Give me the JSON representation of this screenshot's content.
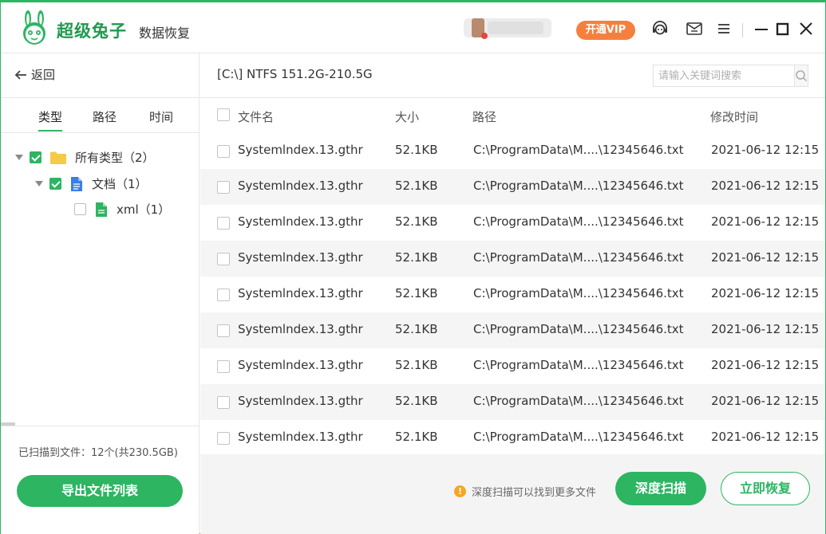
{
  "app": {
    "brand": "超级兔子",
    "product": "数据恢复",
    "vip_label": "开通VIP"
  },
  "titlebar_icons": [
    "support-icon",
    "message-icon",
    "menu-icon",
    "minimize-icon",
    "maximize-icon",
    "close-icon"
  ],
  "sidebar": {
    "back_label": "返回",
    "tabs": [
      {
        "label": "类型",
        "active": true
      },
      {
        "label": "路径",
        "active": false
      },
      {
        "label": "时间",
        "active": false
      }
    ],
    "tree": [
      {
        "label": "所有类型（2）",
        "checked": true,
        "icon": "folder-icon"
      },
      {
        "label": "文档（1）",
        "checked": true,
        "icon": "document-icon"
      },
      {
        "label": "xml（1）",
        "checked": false,
        "icon": "xml-file-icon"
      }
    ],
    "scan_count": "已扫描到文件：12个(共230.5GB)",
    "export_label": "导出文件列表"
  },
  "main": {
    "path_label": "[C:\\] NTFS 151.2G-210.5G",
    "search_placeholder": "请输入关键词搜索",
    "columns": [
      "文件名",
      "大小",
      "路径",
      "修改时间"
    ],
    "rows": [
      {
        "name": "Systemlndex.13.gthr",
        "size": "52.1KB",
        "path": "C:\\ProgramData\\M....\\12345646.txt",
        "modified": "2021-06-12 12:15"
      },
      {
        "name": "Systemlndex.13.gthr",
        "size": "52.1KB",
        "path": "C:\\ProgramData\\M....\\12345646.txt",
        "modified": "2021-06-12 12:15"
      },
      {
        "name": "Systemlndex.13.gthr",
        "size": "52.1KB",
        "path": "C:\\ProgramData\\M....\\12345646.txt",
        "modified": "2021-06-12 12:15"
      },
      {
        "name": "Systemlndex.13.gthr",
        "size": "52.1KB",
        "path": "C:\\ProgramData\\M....\\12345646.txt",
        "modified": "2021-06-12 12:15"
      },
      {
        "name": "Systemlndex.13.gthr",
        "size": "52.1KB",
        "path": "C:\\ProgramData\\M....\\12345646.txt",
        "modified": "2021-06-12 12:15"
      },
      {
        "name": "Systemlndex.13.gthr",
        "size": "52.1KB",
        "path": "C:\\ProgramData\\M....\\12345646.txt",
        "modified": "2021-06-12 12:15"
      },
      {
        "name": "Systemlndex.13.gthr",
        "size": "52.1KB",
        "path": "C:\\ProgramData\\M....\\12345646.txt",
        "modified": "2021-06-12 12:15"
      },
      {
        "name": "Systemlndex.13.gthr",
        "size": "52.1KB",
        "path": "C:\\ProgramData\\M....\\12345646.txt",
        "modified": "2021-06-12 12:15"
      },
      {
        "name": "Systemlndex.13.gthr",
        "size": "52.1KB",
        "path": "C:\\ProgramData\\M....\\12345646.txt",
        "modified": "2021-06-12 12:15"
      }
    ],
    "hint": "深度扫描可以找到更多文件",
    "deep_scan_label": "深度扫描",
    "recover_label": "立即恢复"
  },
  "colors": {
    "accent": "#2db562",
    "vip": "#f5803e",
    "hint": "#f5a623"
  }
}
